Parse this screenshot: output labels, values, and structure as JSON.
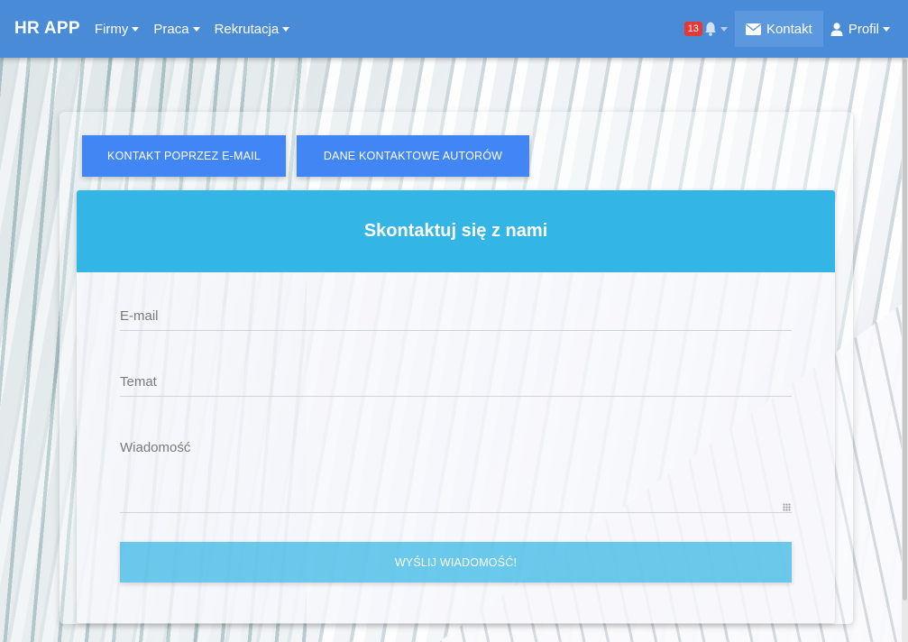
{
  "navbar": {
    "brand": "HR APP",
    "menu": [
      {
        "label": "Firmy"
      },
      {
        "label": "Praca"
      },
      {
        "label": "Rekrutacja"
      }
    ],
    "notifications_count": "13",
    "contact_label": "Kontakt",
    "profile_label": "Profil",
    "color": "#4a8bd8"
  },
  "tabs": {
    "email_contact": "KONTAKT POPRZEZ E-MAIL",
    "authors_contact": "DANE KONTAKTOWE AUTORÓW"
  },
  "form": {
    "title": "Skontaktuj się z nami",
    "email_placeholder": "E-mail",
    "subject_placeholder": "Temat",
    "message_placeholder": "Wiadomość",
    "submit_label": "WYŚLIJ WIADOMOŚĆ!",
    "header_color": "#33b5e5",
    "button_color": "#4285f4"
  }
}
